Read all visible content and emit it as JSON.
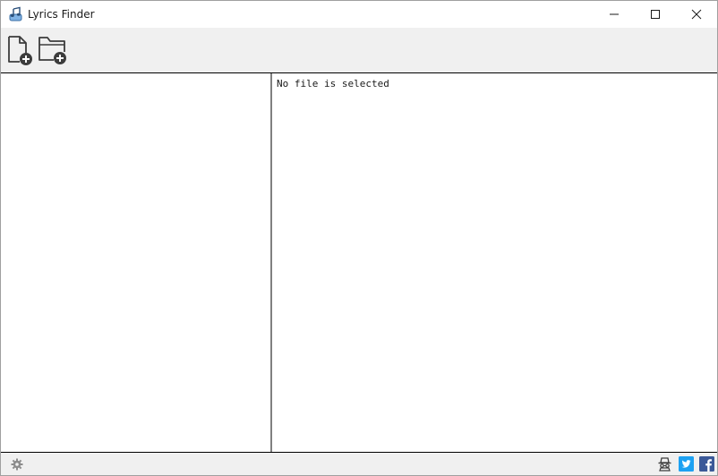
{
  "window": {
    "title": "Lyrics Finder",
    "icon": "music-note-app-icon"
  },
  "titlebar_buttons": [
    "minimize-icon",
    "maximize-icon",
    "close-icon"
  ],
  "toolbar": {
    "items": [
      {
        "name": "add-file-button",
        "icon": "file-plus-icon"
      },
      {
        "name": "add-folder-button",
        "icon": "folder-plus-icon"
      }
    ]
  },
  "details": {
    "message": "No file is selected"
  },
  "footer": {
    "icons": [
      "gear-icon",
      "incognito-icon",
      "twitter-icon",
      "facebook-icon"
    ],
    "twitter_color": "#1da1f2",
    "facebook_color": "#3b5998"
  }
}
